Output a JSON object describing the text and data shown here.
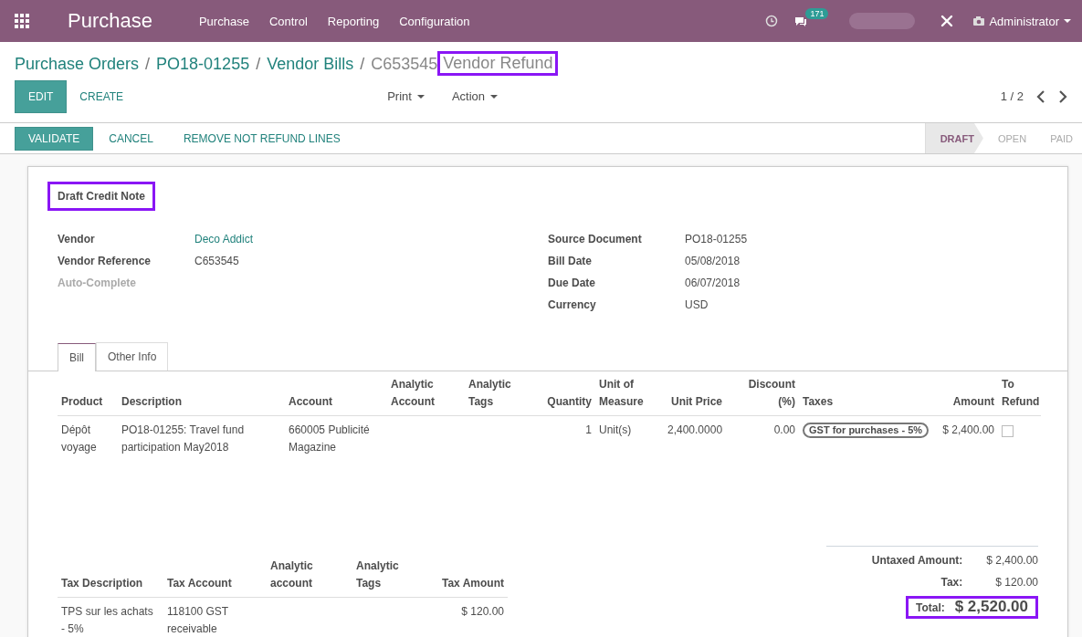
{
  "navbar": {
    "app_title": "Purchase",
    "menu": [
      "Purchase",
      "Control",
      "Reporting",
      "Configuration"
    ],
    "messages_count": "171",
    "user": "Administrator"
  },
  "breadcrumbs": [
    {
      "label": "Purchase Orders",
      "kind": "link",
      "highlighted": false,
      "separator": "/"
    },
    {
      "label": "PO18-01255",
      "kind": "link",
      "highlighted": false,
      "separator": "/"
    },
    {
      "label": "Vendor Bills",
      "kind": "link",
      "highlighted": false,
      "separator": "/"
    },
    {
      "label": "C653545",
      "kind": "current",
      "highlighted": false
    },
    {
      "label": "Vendor Refund",
      "kind": "current",
      "highlighted": true
    }
  ],
  "buttons": [
    {
      "label": "EDIT",
      "kind": "primary"
    },
    {
      "label": "CREATE",
      "kind": "link"
    }
  ],
  "dropdowns": [
    "Print",
    "Action"
  ],
  "pager": "1 / 2",
  "header_buttons": [
    {
      "label": "VALIDATE",
      "kind": "primary"
    },
    {
      "label": "CANCEL",
      "kind": "link"
    },
    {
      "label": "REMOVE NOT REFUND LINES",
      "kind": "link"
    }
  ],
  "stages": [
    {
      "label": "DRAFT",
      "selected": true
    },
    {
      "label": "OPEN",
      "selected": false
    },
    {
      "label": "PAID",
      "selected": false
    }
  ],
  "sheet": {
    "title": "Draft Credit Note",
    "title_highlighted": true,
    "left_fields": [
      {
        "label": "Vendor",
        "value": "Deco Addict",
        "kind": "link"
      },
      {
        "label": "Vendor Reference",
        "value": "C653545",
        "kind": "text"
      },
      {
        "label": "Auto-Complete",
        "kind": "placeholder"
      }
    ],
    "right_fields": [
      {
        "label": "Source Document",
        "value": "PO18-01255"
      },
      {
        "label": "Bill Date",
        "value": "05/08/2018"
      },
      {
        "label": "Due Date",
        "value": "06/07/2018"
      },
      {
        "label": "Currency",
        "value": "USD"
      }
    ]
  },
  "tabs": [
    {
      "label": "Bill",
      "selected": true
    },
    {
      "label": "Other Info",
      "selected": false
    }
  ],
  "lines": {
    "columns": [
      "Product",
      "Description",
      "Account",
      "Analytic Account",
      "Analytic Tags",
      "Quantity",
      "Unit of Measure",
      "Unit Price",
      "Discount (%)",
      "Taxes",
      "Amount",
      "To Refund"
    ],
    "rows": [
      {
        "product": "Dépôt voyage",
        "description": "PO18-01255: Travel fund participation May2018",
        "account": "660005 Publicité Magazine",
        "quantity": "1",
        "uom": "Unit(s)",
        "unit_price": "2,400.0000",
        "discount": "0.00",
        "taxes": [
          "GST for purchases - 5%"
        ],
        "amount": "$ 2,400.00",
        "to_refund": false
      }
    ]
  },
  "tax_lines": {
    "columns": [
      "Tax Description",
      "Tax Account",
      "Analytic account",
      "Analytic Tags",
      "Tax Amount"
    ],
    "rows": [
      {
        "description": "TPS sur les achats - 5%",
        "account": "118100 GST receivable",
        "amount": "$ 120.00"
      }
    ]
  },
  "totals": [
    {
      "label": "Untaxed Amount:",
      "value": "$ 2,400.00",
      "kind": "subtotal",
      "highlighted": false
    },
    {
      "label": "Tax:",
      "value": "$ 120.00",
      "kind": "subtotal",
      "highlighted": false
    },
    {
      "label": "Total:",
      "value": "$ 2,520.00",
      "kind": "total",
      "highlighted": true
    }
  ]
}
